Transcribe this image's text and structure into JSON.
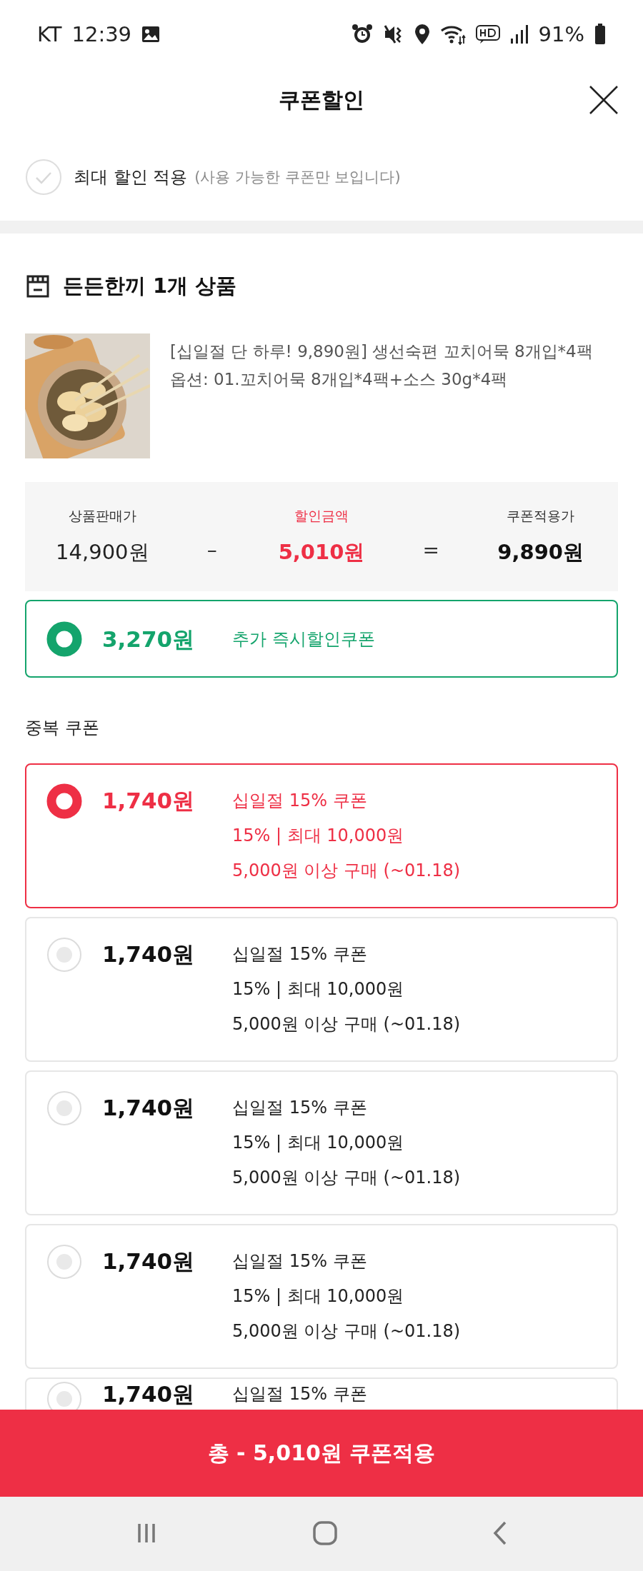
{
  "status_bar": {
    "carrier": "KT",
    "time": "12:39",
    "battery": "91%"
  },
  "header": {
    "title": "쿠폰할인"
  },
  "max_discount": {
    "label": "최대 할인 적용",
    "note": "(사용 가능한 쿠폰만 보입니다)",
    "checked": false
  },
  "store": {
    "name": "든든한끼 1개 상품"
  },
  "product": {
    "title": "[십일절 단 하루! 9,890원] 생선숙편 꼬치어묵 8개입*4팩",
    "option": "옵션: 01.꼬치어묵 8개입*4팩+소스 30g*4팩"
  },
  "summary": {
    "columns": [
      {
        "label": "상품판매가",
        "value": "14,900원",
        "kind": "price"
      },
      {
        "label": "할인금액",
        "value": "5,010원",
        "kind": "discount"
      },
      {
        "label": "쿠폰적용가",
        "value": "9,890원",
        "kind": "total"
      }
    ],
    "operators": [
      "–",
      "="
    ]
  },
  "instant_coupon": {
    "amount": "3,270원",
    "name": "추가 즉시할인쿠폰",
    "selected": true
  },
  "stack_section": {
    "title": "중복 쿠폰"
  },
  "coupons": [
    {
      "amount": "1,740원",
      "name": "십일절 15% 쿠폰",
      "terms": "15% | 최대 10,000원",
      "condition": "5,000원 이상 구매 (~01.18)",
      "selected": true
    },
    {
      "amount": "1,740원",
      "name": "십일절 15% 쿠폰",
      "terms": "15% | 최대 10,000원",
      "condition": "5,000원 이상 구매 (~01.18)",
      "selected": false
    },
    {
      "amount": "1,740원",
      "name": "십일절 15% 쿠폰",
      "terms": "15% | 최대 10,000원",
      "condition": "5,000원 이상 구매 (~01.18)",
      "selected": false
    },
    {
      "amount": "1,740원",
      "name": "십일절 15% 쿠폰",
      "terms": "15% | 최대 10,000원",
      "condition": "5,000원 이상 구매 (~01.18)",
      "selected": false
    },
    {
      "amount": "1,740원",
      "name": "십일절 15% 쿠폰",
      "selected": false
    }
  ],
  "apply_button": {
    "label": "총 - 5,010원 쿠폰적용"
  }
}
